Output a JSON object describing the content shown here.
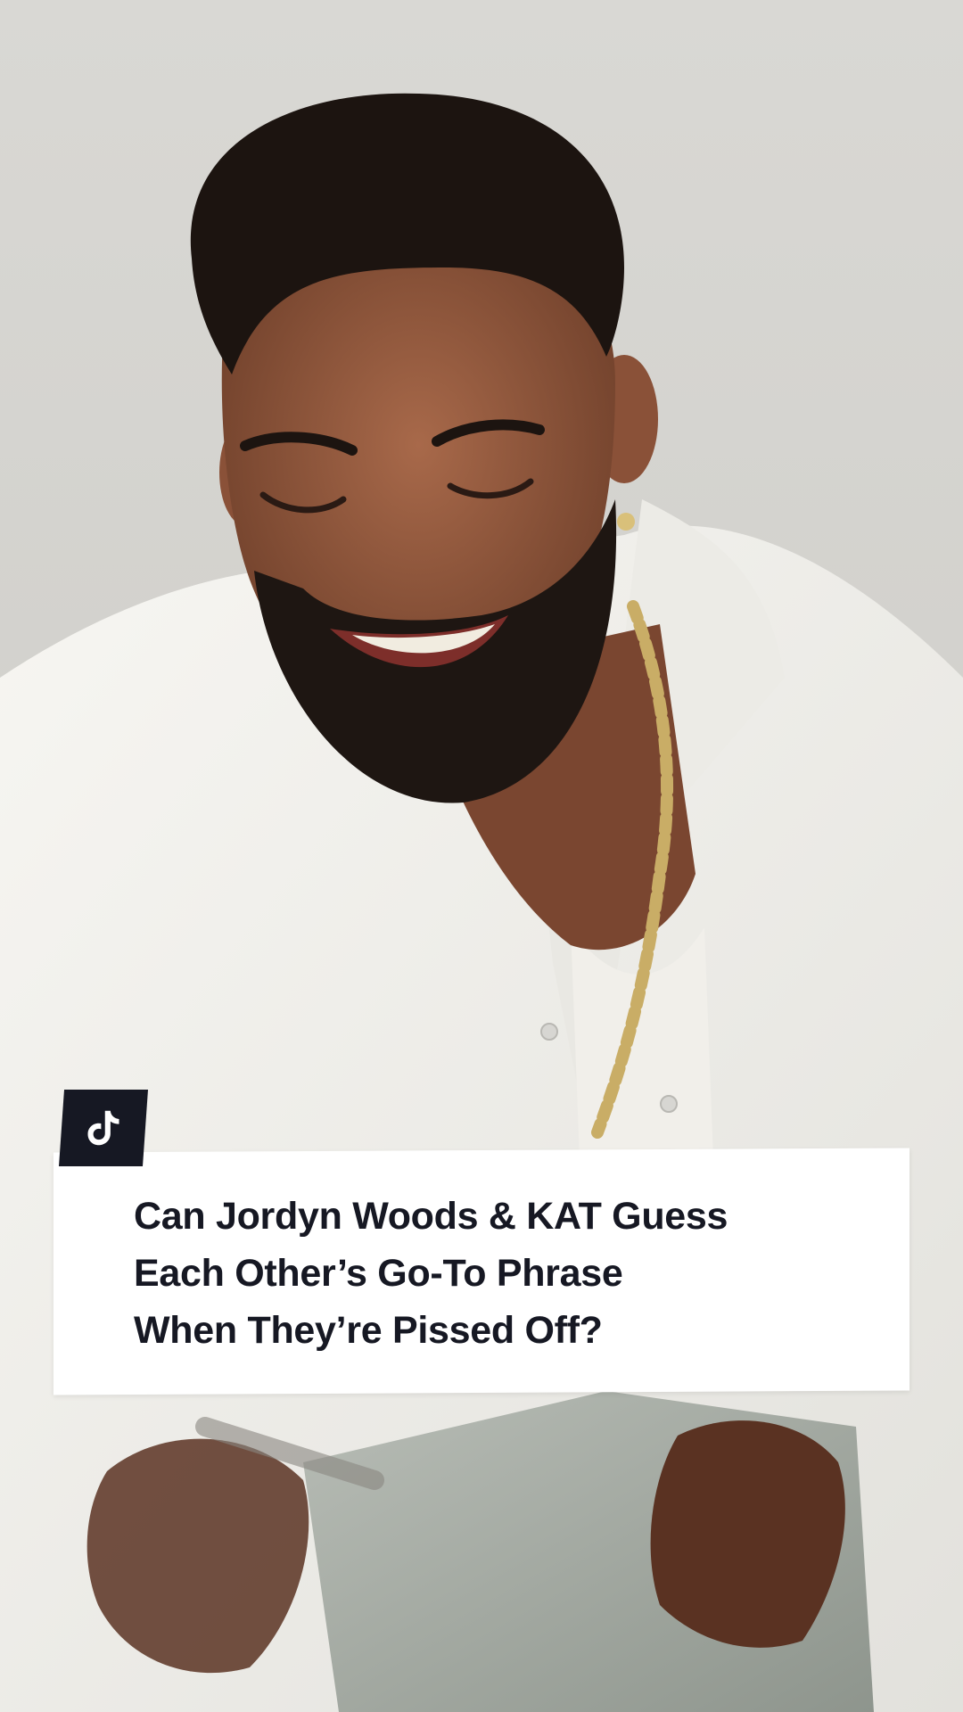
{
  "caption": {
    "lines": [
      "Can Jordyn Woods & KAT Guess",
      "Each Other’s Go-To Phrase",
      "When They’re Pissed Off?"
    ]
  },
  "logo": {
    "icon": "tiktok-logo-icon"
  },
  "colors": {
    "caption_text": "#161823",
    "caption_bg": "#ffffff",
    "badge_bg": "#161823",
    "backdrop": "#d6d5d1",
    "shirt": "#f3f2ee"
  }
}
